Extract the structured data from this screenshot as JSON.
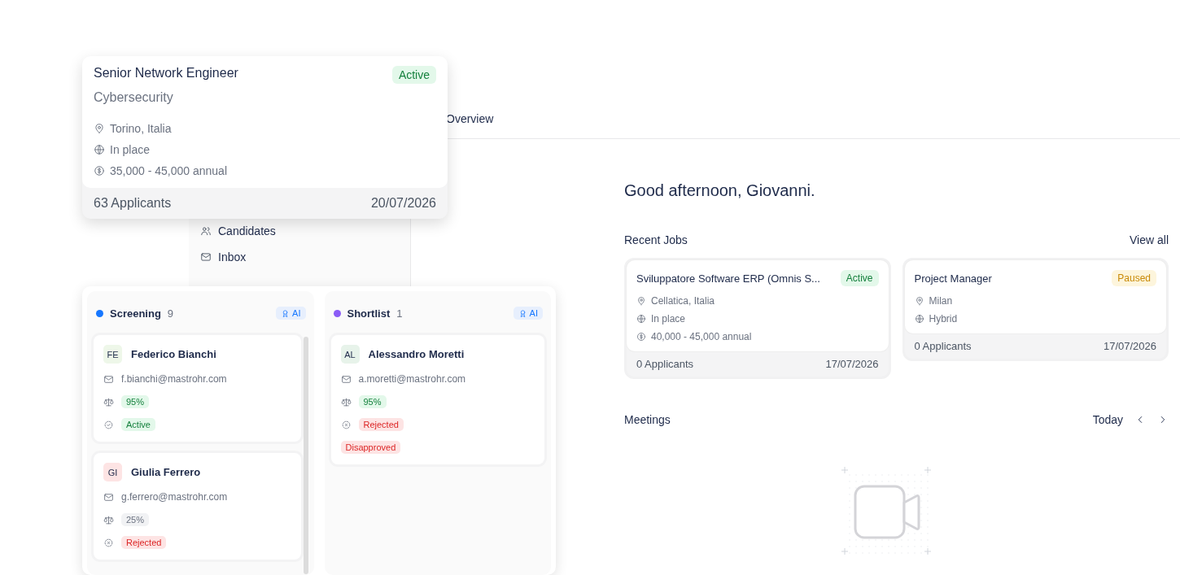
{
  "dashboard": {
    "tab": {
      "label": "Overview",
      "selected": true
    },
    "sidebar_items": [
      {
        "label": "Candidates"
      },
      {
        "label": "Inbox"
      }
    ],
    "greeting": "Good afternoon, Giovanni.",
    "recent_jobs": {
      "title": "Recent Jobs",
      "link": "View all",
      "jobs": [
        {
          "title": "Sviluppatore Software ERP (Omnis S...",
          "status": {
            "label": "Active",
            "kind": "active"
          },
          "location": "Cellatica, Italia",
          "work_mode": "In place",
          "salary": "40,000 - 45,000 annual",
          "applicants": "0 Applicants",
          "date": "17/07/2026"
        },
        {
          "title": "Project Manager",
          "status": {
            "label": "Paused",
            "kind": "paused"
          },
          "location": "Milan",
          "work_mode": "Hybrid",
          "applicants": "0 Applicants",
          "date": "17/07/2026"
        }
      ]
    },
    "meetings": {
      "title": "Meetings",
      "today": "Today"
    }
  },
  "job_card": {
    "title": "Senior Network Engineer",
    "department": "Cybersecurity",
    "status": {
      "label": "Active",
      "kind": "active"
    },
    "location": "Torino, Italia",
    "work_mode": "In place",
    "salary": "35,000 - 45,000 annual",
    "applicants": "63 Applicants",
    "date": "20/07/2026"
  },
  "pipeline": {
    "columns": [
      {
        "name": "Screening",
        "count": "9",
        "color": "#1677ff",
        "ai": "AI",
        "candidates": [
          {
            "initials": "FE",
            "color": "#eef7e9",
            "name": "Federico Bianchi",
            "email": "f.bianchi@mastrohr.com",
            "score": {
              "label": "95%",
              "kind": "success"
            },
            "status": {
              "label": "Active",
              "kind": "success"
            }
          },
          {
            "initials": "GI",
            "color": "#fde4e4",
            "name": "Giulia Ferrero",
            "email": "g.ferrero@mastrohr.com",
            "score": {
              "label": "25%",
              "kind": "neutral"
            },
            "status": {
              "label": "Rejected",
              "kind": "danger"
            }
          }
        ]
      },
      {
        "name": "Shortlist",
        "count": "1",
        "color": "#8b5cf6",
        "ai": "AI",
        "candidates": [
          {
            "initials": "AL",
            "color": "#e7f3ea",
            "name": "Alessandro Moretti",
            "email": "a.moretti@mastrohr.com",
            "score": {
              "label": "95%",
              "kind": "success"
            },
            "status": {
              "label": "Rejected",
              "kind": "danger"
            },
            "tags": [
              {
                "label": "Disapproved",
                "kind": "danger"
              }
            ]
          }
        ]
      }
    ]
  }
}
